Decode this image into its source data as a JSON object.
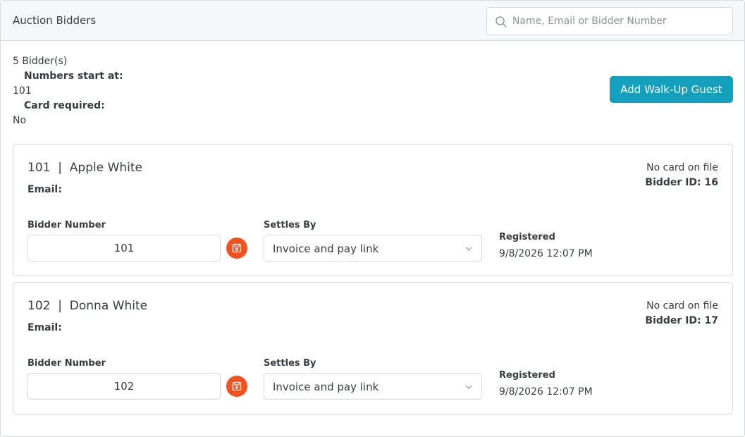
{
  "header": {
    "title": "Auction Bidders",
    "search_placeholder": "Name, Email or Bidder Number"
  },
  "summary": {
    "count": "5 Bidder(s)",
    "numbers_start_label": "Numbers start at:",
    "numbers_start_value": "101",
    "card_required_label": "Card required:",
    "card_required_value": "No"
  },
  "add_button_label": "Add Walk-Up Guest",
  "field_labels": {
    "bidder_number": "Bidder Number",
    "settles_by": "Settles By",
    "registered": "Registered",
    "email": "Email:"
  },
  "bidders": [
    {
      "title": "101  |  Apple White",
      "card_status": "No card on file",
      "bidder_id": "Bidder ID: 16",
      "bidder_number": "101",
      "settles_by": "Invoice and pay link",
      "registered": "9/8/2026 12:07 PM"
    },
    {
      "title": "102  |  Donna White",
      "card_status": "No card on file",
      "bidder_id": "Bidder ID: 17",
      "bidder_number": "102",
      "settles_by": "Invoice and pay link",
      "registered": "9/8/2026 12:07 PM"
    }
  ],
  "colors": {
    "accent": "#14a0bd",
    "save": "#f4511e",
    "border": "#d6d9dc"
  },
  "icons": {
    "search": "search-icon",
    "save": "save-icon",
    "dropdown": "chevron-down-icon"
  }
}
